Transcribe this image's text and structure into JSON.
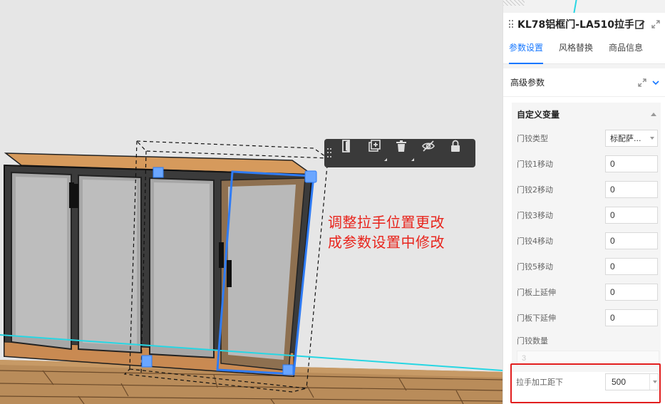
{
  "toolbar": {
    "buttons": [
      {
        "icon": "door-icon",
        "label": ""
      },
      {
        "icon": "add-copy-icon",
        "label": ""
      },
      {
        "icon": "trash-icon",
        "label": ""
      },
      {
        "icon": "hide-icon",
        "label": ""
      },
      {
        "icon": "lock-icon",
        "label": ""
      }
    ]
  },
  "annotation": {
    "line1": "调整拉手位置更改",
    "line2": "成参数设置中修改",
    "color": "#e8241c"
  },
  "panel": {
    "title": "KL78铝框门-LA510拉手",
    "tabs": [
      {
        "label": "参数设置",
        "active": true
      },
      {
        "label": "风格替换",
        "active": false
      },
      {
        "label": "商品信息",
        "active": false
      }
    ],
    "section_title": "高级参数",
    "group_title": "自定义变量",
    "params": [
      {
        "label": "门铰类型",
        "type": "select",
        "value": "标配萨..."
      },
      {
        "label": "门铰1移动",
        "type": "input",
        "value": "0"
      },
      {
        "label": "门铰2移动",
        "type": "input",
        "value": "0"
      },
      {
        "label": "门铰3移动",
        "type": "input",
        "value": "0"
      },
      {
        "label": "门铰4移动",
        "type": "input",
        "value": "0"
      },
      {
        "label": "门铰5移动",
        "type": "input",
        "value": "0"
      },
      {
        "label": "门板上延伸",
        "type": "input",
        "value": "0"
      },
      {
        "label": "门板下延伸",
        "type": "input",
        "value": "0"
      }
    ],
    "hinge_count": {
      "label": "门铰数量",
      "value": "3"
    },
    "handle_offset": {
      "label": "拉手加工距下",
      "value": "500"
    }
  },
  "colors": {
    "accent": "#1677ff",
    "highlight": "#e11d1d",
    "selection": "#2f7cf6",
    "floor_line": "#27d6e3"
  }
}
